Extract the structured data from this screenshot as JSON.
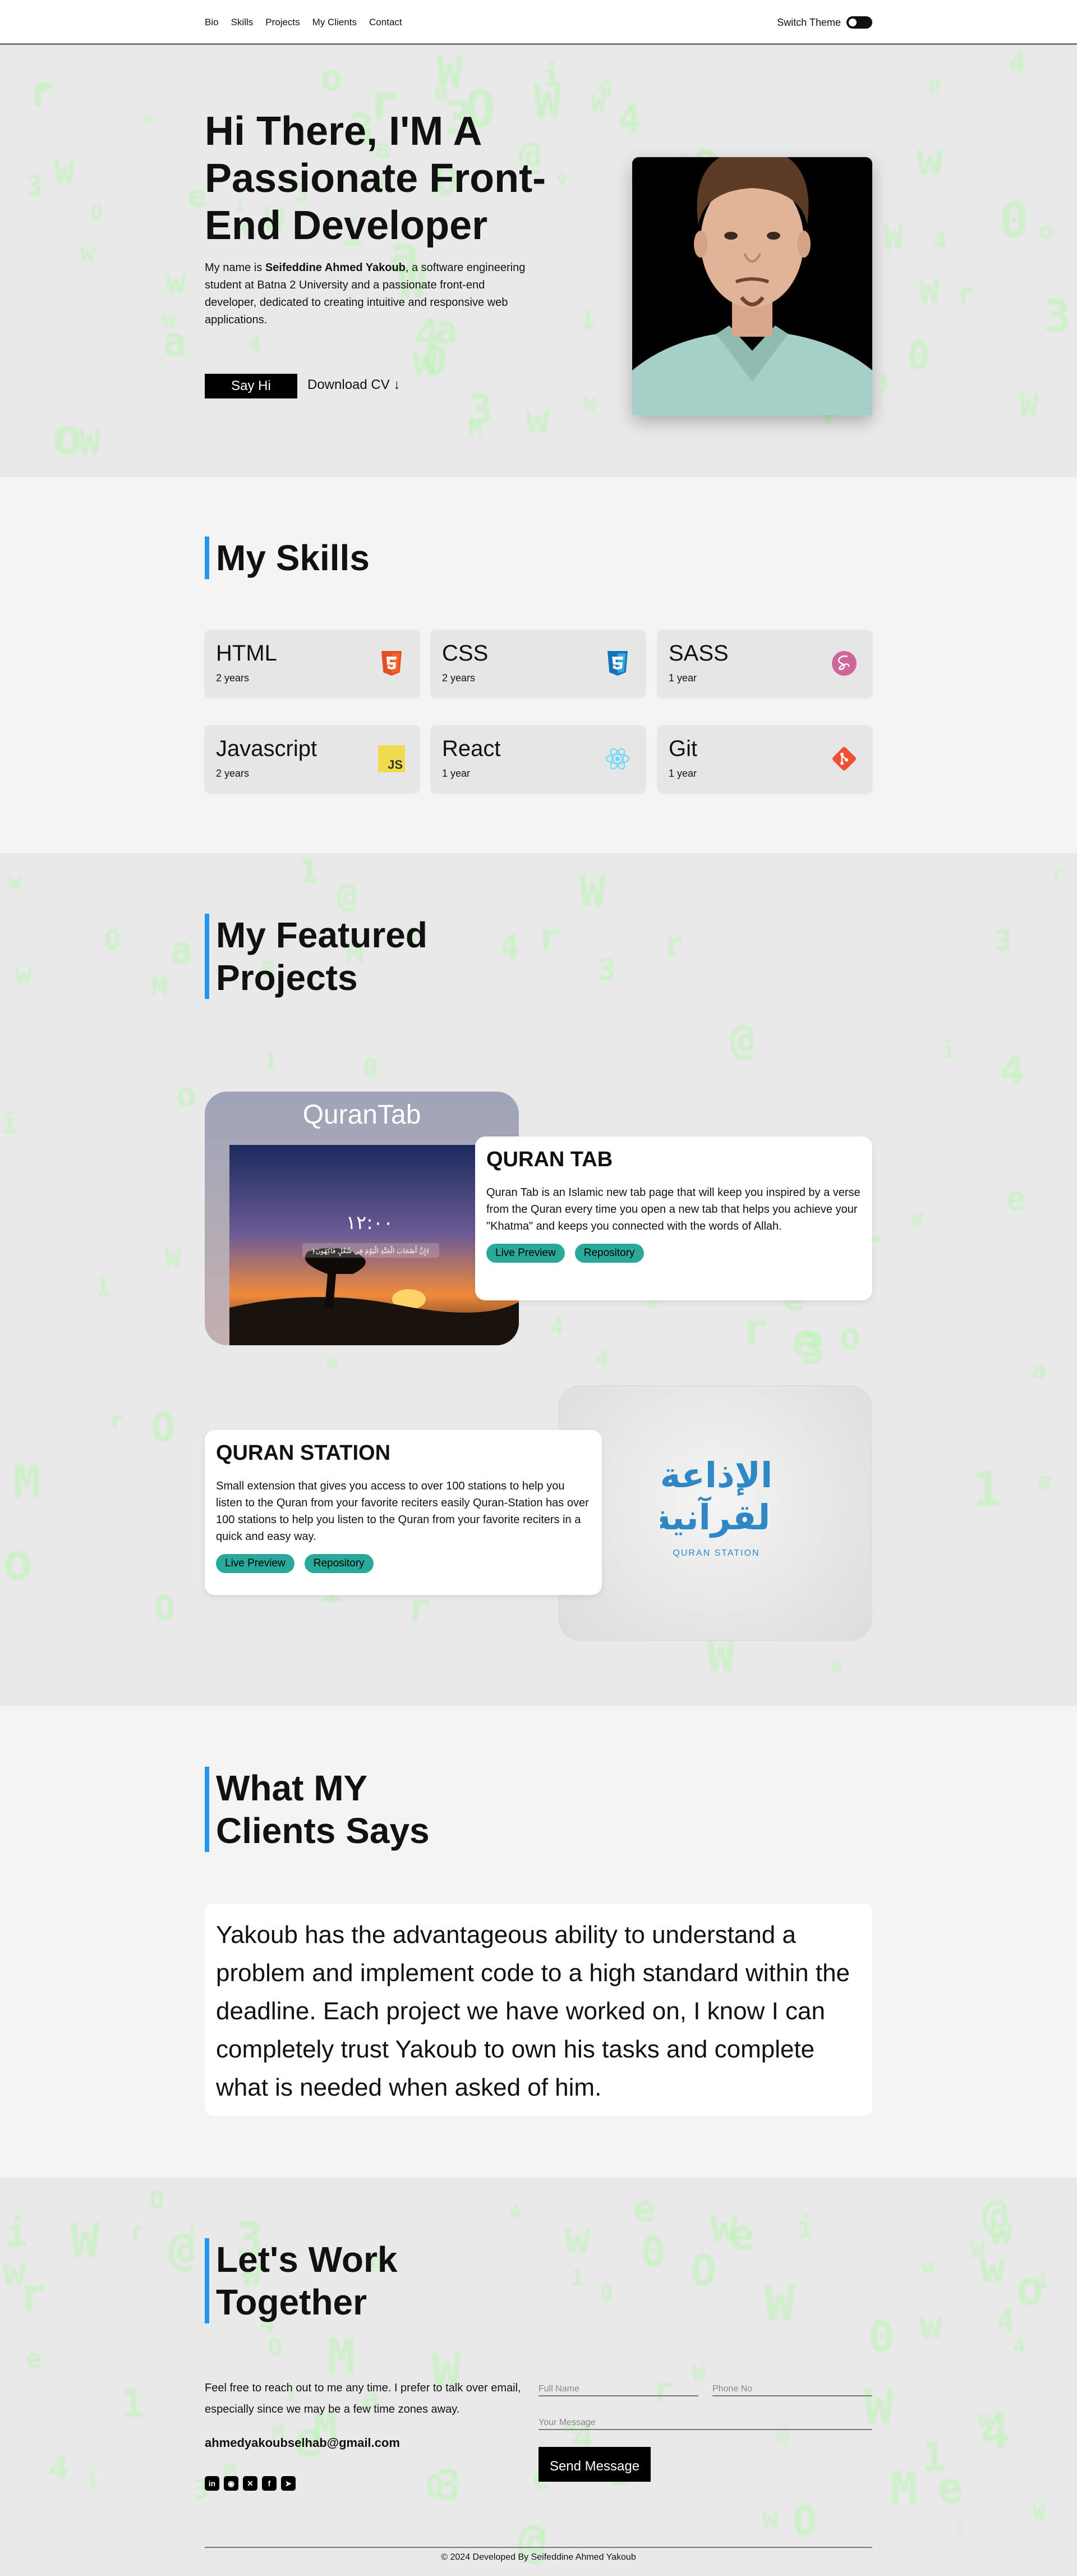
{
  "nav": {
    "links": [
      "Bio",
      "Skills",
      "Projects",
      "My Clients",
      "Contact"
    ],
    "theme_label": "Switch Theme"
  },
  "hero": {
    "title": "Hi There, I'M A Passionate Front-End Developer",
    "intro_prefix": "My name is ",
    "intro_name": "Seifeddine Ahmed Yakoub",
    "intro_suffix": ", a software engineering student at Batna 2 University and a passionate front-end developer, dedicated to creating intuitive and responsive web applications.",
    "say_hi": "Say Hi",
    "download_cv": "Download CV ↓"
  },
  "skills": {
    "title": "My Skills",
    "items": [
      {
        "name": "HTML",
        "years": "2 years",
        "icon": "html5-icon",
        "color": "#e44d26"
      },
      {
        "name": "CSS",
        "years": "2 years",
        "icon": "css3-icon",
        "color": "#1572b6"
      },
      {
        "name": "SASS",
        "years": "1 year",
        "icon": "sass-icon",
        "color": "#cd6799"
      },
      {
        "name": "Javascript",
        "years": "2 years",
        "icon": "javascript-icon",
        "color": "#f0db4f"
      },
      {
        "name": "React",
        "years": "1 year",
        "icon": "react-icon",
        "color": "#61dafb"
      },
      {
        "name": "Git",
        "years": "1 year",
        "icon": "git-icon",
        "color": "#f05033"
      }
    ]
  },
  "projects": {
    "title_line1": "My Featured",
    "title_line2": "Projects",
    "items": [
      {
        "name": "QURAN TAB",
        "image_caption": "QuranTab",
        "description": "Quran Tab is an Islamic new tab page that will keep you inspired by a verse from the Quran every time you open a new tab that helps you achieve your \"Khatma\" and keeps you connected with the words of Allah.",
        "live": "Live Preview",
        "repo": "Repository",
        "screen_time": "١٢:٠٠",
        "screen_verse": "﴿إِنَّ أَصْحَابَ الْجَنَّةِ الْيَوْمَ فِي شُغُلٍ فَاكِهُونَ﴾"
      },
      {
        "name": "QURAN STATION",
        "image_caption": "QURAN STATION",
        "logo_arabic_1": "الإذاعة",
        "logo_arabic_2": "القرآنية",
        "description": "Small extension that gives you access to over 100 stations to help you listen to the Quran from your favorite reciters easily Quran-Station has over 100 stations to help you listen to the Quran from your favorite reciters in a quick and easy way.",
        "live": "Live Preview",
        "repo": "Repository"
      }
    ]
  },
  "clients": {
    "title_line1": "What MY",
    "title_line2": "Clients Says",
    "quote": "Yakoub has the advantageous ability to understand a problem and implement code to a high standard within the deadline. Each project we have worked on, I know I can completely trust Yakoub to own his tasks and complete what is needed when asked of him."
  },
  "contact": {
    "title_line1": "Let's Work",
    "title_line2": "Together",
    "text": "Feel free to reach out to me any time. I prefer to talk over email, especially since we may be a few time zones away.",
    "email": "ahmedyakoubselhab@gmail.com",
    "socials": [
      "linkedin-icon",
      "github-icon",
      "twitter-icon",
      "facebook-icon",
      "telegram-icon"
    ],
    "fullname_placeholder": "Full Name",
    "phone_placeholder": "Phone No",
    "message_placeholder": "Your Message",
    "send": "Send Message",
    "footer": "© 2024 Developed By Seifeddine Ahmed Yakoub"
  }
}
